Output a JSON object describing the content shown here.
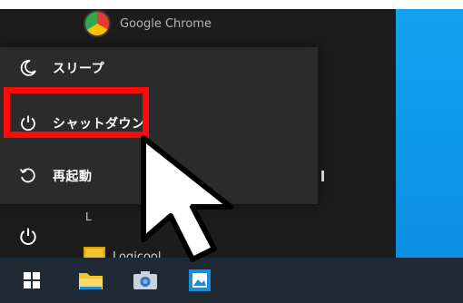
{
  "background_app": {
    "label": "Google Chrome",
    "icon": "chrome-icon"
  },
  "power_menu": {
    "items": [
      {
        "label": "スリープ",
        "icon": "moon-icon"
      },
      {
        "label": "シャットダウン",
        "icon": "power-icon"
      },
      {
        "label": "再起動",
        "icon": "restart-icon"
      }
    ]
  },
  "app_list": {
    "section_letter": "L",
    "app_label": "Logicool",
    "expand_glyph": "⌄"
  },
  "taskbar": {
    "buttons": [
      {
        "name": "start-button",
        "icon": "windows-icon"
      },
      {
        "name": "file-explorer-button",
        "icon": "folder-icon"
      },
      {
        "name": "camera-button",
        "icon": "camera-icon"
      },
      {
        "name": "photos-button",
        "icon": "photos-icon"
      }
    ]
  },
  "colors": {
    "highlight": "#ff0a0a",
    "desktop": "#13a2ee",
    "menu_bg": "#2b2b2b",
    "taskbar_bg": "#1f2a35"
  }
}
